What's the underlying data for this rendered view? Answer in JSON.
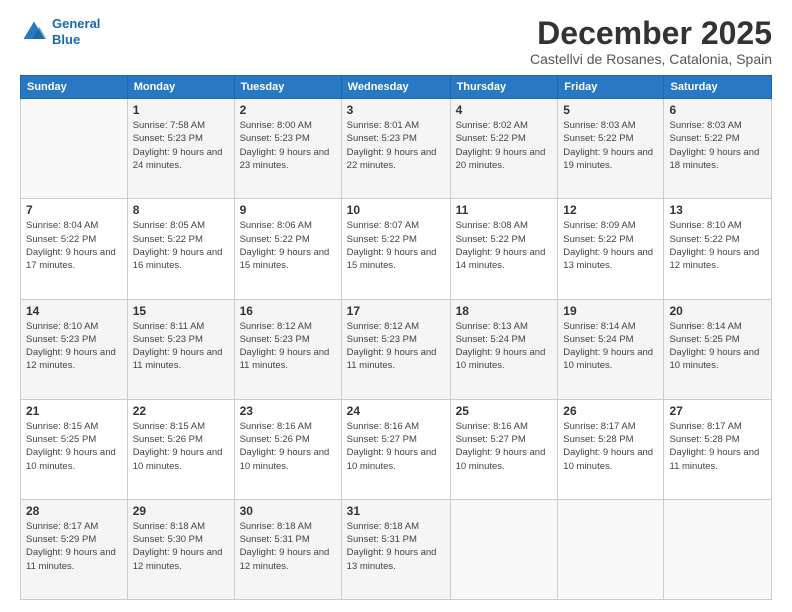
{
  "logo": {
    "line1": "General",
    "line2": "Blue"
  },
  "header": {
    "month": "December 2025",
    "location": "Castellvi de Rosanes, Catalonia, Spain"
  },
  "weekdays": [
    "Sunday",
    "Monday",
    "Tuesday",
    "Wednesday",
    "Thursday",
    "Friday",
    "Saturday"
  ],
  "weeks": [
    [
      {
        "day": "",
        "sunrise": "",
        "sunset": "",
        "daylight": ""
      },
      {
        "day": "1",
        "sunrise": "Sunrise: 7:58 AM",
        "sunset": "Sunset: 5:23 PM",
        "daylight": "Daylight: 9 hours and 24 minutes."
      },
      {
        "day": "2",
        "sunrise": "Sunrise: 8:00 AM",
        "sunset": "Sunset: 5:23 PM",
        "daylight": "Daylight: 9 hours and 23 minutes."
      },
      {
        "day": "3",
        "sunrise": "Sunrise: 8:01 AM",
        "sunset": "Sunset: 5:23 PM",
        "daylight": "Daylight: 9 hours and 22 minutes."
      },
      {
        "day": "4",
        "sunrise": "Sunrise: 8:02 AM",
        "sunset": "Sunset: 5:22 PM",
        "daylight": "Daylight: 9 hours and 20 minutes."
      },
      {
        "day": "5",
        "sunrise": "Sunrise: 8:03 AM",
        "sunset": "Sunset: 5:22 PM",
        "daylight": "Daylight: 9 hours and 19 minutes."
      },
      {
        "day": "6",
        "sunrise": "Sunrise: 8:03 AM",
        "sunset": "Sunset: 5:22 PM",
        "daylight": "Daylight: 9 hours and 18 minutes."
      }
    ],
    [
      {
        "day": "7",
        "sunrise": "Sunrise: 8:04 AM",
        "sunset": "Sunset: 5:22 PM",
        "daylight": "Daylight: 9 hours and 17 minutes."
      },
      {
        "day": "8",
        "sunrise": "Sunrise: 8:05 AM",
        "sunset": "Sunset: 5:22 PM",
        "daylight": "Daylight: 9 hours and 16 minutes."
      },
      {
        "day": "9",
        "sunrise": "Sunrise: 8:06 AM",
        "sunset": "Sunset: 5:22 PM",
        "daylight": "Daylight: 9 hours and 15 minutes."
      },
      {
        "day": "10",
        "sunrise": "Sunrise: 8:07 AM",
        "sunset": "Sunset: 5:22 PM",
        "daylight": "Daylight: 9 hours and 15 minutes."
      },
      {
        "day": "11",
        "sunrise": "Sunrise: 8:08 AM",
        "sunset": "Sunset: 5:22 PM",
        "daylight": "Daylight: 9 hours and 14 minutes."
      },
      {
        "day": "12",
        "sunrise": "Sunrise: 8:09 AM",
        "sunset": "Sunset: 5:22 PM",
        "daylight": "Daylight: 9 hours and 13 minutes."
      },
      {
        "day": "13",
        "sunrise": "Sunrise: 8:10 AM",
        "sunset": "Sunset: 5:22 PM",
        "daylight": "Daylight: 9 hours and 12 minutes."
      }
    ],
    [
      {
        "day": "14",
        "sunrise": "Sunrise: 8:10 AM",
        "sunset": "Sunset: 5:23 PM",
        "daylight": "Daylight: 9 hours and 12 minutes."
      },
      {
        "day": "15",
        "sunrise": "Sunrise: 8:11 AM",
        "sunset": "Sunset: 5:23 PM",
        "daylight": "Daylight: 9 hours and 11 minutes."
      },
      {
        "day": "16",
        "sunrise": "Sunrise: 8:12 AM",
        "sunset": "Sunset: 5:23 PM",
        "daylight": "Daylight: 9 hours and 11 minutes."
      },
      {
        "day": "17",
        "sunrise": "Sunrise: 8:12 AM",
        "sunset": "Sunset: 5:23 PM",
        "daylight": "Daylight: 9 hours and 11 minutes."
      },
      {
        "day": "18",
        "sunrise": "Sunrise: 8:13 AM",
        "sunset": "Sunset: 5:24 PM",
        "daylight": "Daylight: 9 hours and 10 minutes."
      },
      {
        "day": "19",
        "sunrise": "Sunrise: 8:14 AM",
        "sunset": "Sunset: 5:24 PM",
        "daylight": "Daylight: 9 hours and 10 minutes."
      },
      {
        "day": "20",
        "sunrise": "Sunrise: 8:14 AM",
        "sunset": "Sunset: 5:25 PM",
        "daylight": "Daylight: 9 hours and 10 minutes."
      }
    ],
    [
      {
        "day": "21",
        "sunrise": "Sunrise: 8:15 AM",
        "sunset": "Sunset: 5:25 PM",
        "daylight": "Daylight: 9 hours and 10 minutes."
      },
      {
        "day": "22",
        "sunrise": "Sunrise: 8:15 AM",
        "sunset": "Sunset: 5:26 PM",
        "daylight": "Daylight: 9 hours and 10 minutes."
      },
      {
        "day": "23",
        "sunrise": "Sunrise: 8:16 AM",
        "sunset": "Sunset: 5:26 PM",
        "daylight": "Daylight: 9 hours and 10 minutes."
      },
      {
        "day": "24",
        "sunrise": "Sunrise: 8:16 AM",
        "sunset": "Sunset: 5:27 PM",
        "daylight": "Daylight: 9 hours and 10 minutes."
      },
      {
        "day": "25",
        "sunrise": "Sunrise: 8:16 AM",
        "sunset": "Sunset: 5:27 PM",
        "daylight": "Daylight: 9 hours and 10 minutes."
      },
      {
        "day": "26",
        "sunrise": "Sunrise: 8:17 AM",
        "sunset": "Sunset: 5:28 PM",
        "daylight": "Daylight: 9 hours and 10 minutes."
      },
      {
        "day": "27",
        "sunrise": "Sunrise: 8:17 AM",
        "sunset": "Sunset: 5:28 PM",
        "daylight": "Daylight: 9 hours and 11 minutes."
      }
    ],
    [
      {
        "day": "28",
        "sunrise": "Sunrise: 8:17 AM",
        "sunset": "Sunset: 5:29 PM",
        "daylight": "Daylight: 9 hours and 11 minutes."
      },
      {
        "day": "29",
        "sunrise": "Sunrise: 8:18 AM",
        "sunset": "Sunset: 5:30 PM",
        "daylight": "Daylight: 9 hours and 12 minutes."
      },
      {
        "day": "30",
        "sunrise": "Sunrise: 8:18 AM",
        "sunset": "Sunset: 5:31 PM",
        "daylight": "Daylight: 9 hours and 12 minutes."
      },
      {
        "day": "31",
        "sunrise": "Sunrise: 8:18 AM",
        "sunset": "Sunset: 5:31 PM",
        "daylight": "Daylight: 9 hours and 13 minutes."
      },
      {
        "day": "",
        "sunrise": "",
        "sunset": "",
        "daylight": ""
      },
      {
        "day": "",
        "sunrise": "",
        "sunset": "",
        "daylight": ""
      },
      {
        "day": "",
        "sunrise": "",
        "sunset": "",
        "daylight": ""
      }
    ]
  ]
}
